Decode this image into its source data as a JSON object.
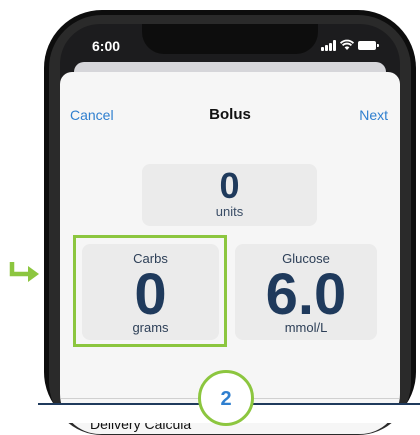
{
  "status_bar": {
    "time": "6:00"
  },
  "nav": {
    "cancel_label": "Cancel",
    "title": "Bolus",
    "next_label": "Next"
  },
  "bolus": {
    "units_value": "0",
    "units_label": "units"
  },
  "carbs": {
    "label": "Carbs",
    "value": "0",
    "unit": "grams"
  },
  "glucose": {
    "label": "Glucose",
    "value": "6.0",
    "unit": "mmol/L"
  },
  "delivery": {
    "label": "Delivery Calcula"
  },
  "callout": {
    "step_number": "2"
  },
  "colors": {
    "accent_blue": "#2f7fcf",
    "value_navy": "#1f3a5c",
    "highlight_green": "#8cc63f"
  }
}
